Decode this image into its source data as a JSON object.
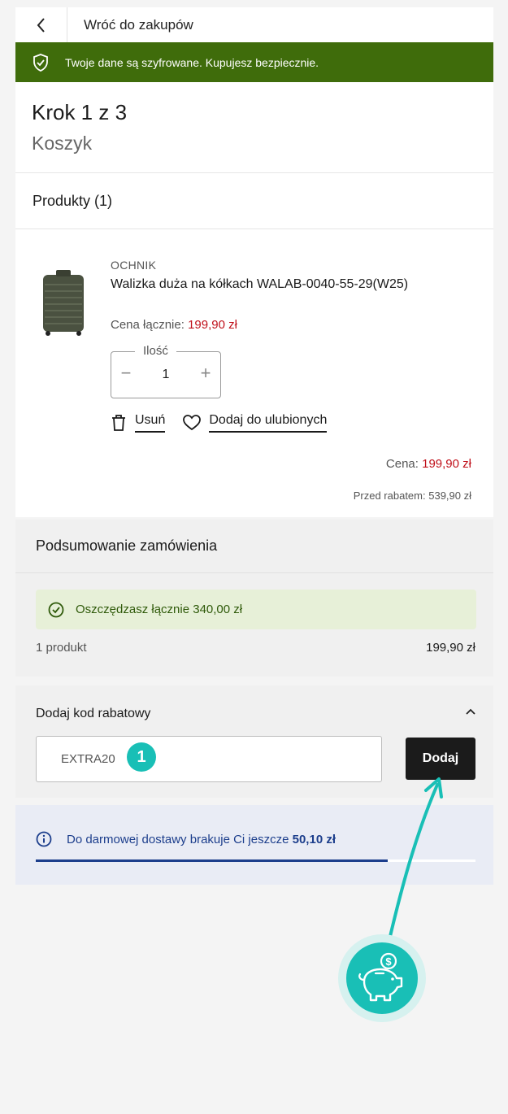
{
  "topbar": {
    "back_label": "Wróć do zakupów"
  },
  "security": {
    "text": "Twoje dane są szyfrowane. Kupujesz bezpiecznie."
  },
  "step": {
    "title": "Krok 1 z 3",
    "subtitle": "Koszyk"
  },
  "products": {
    "heading": "Produkty (1)",
    "items": [
      {
        "brand": "OCHNIK",
        "name": "Walizka duża na kółkach WALAB-0040-55-29(W25)",
        "total_label": "Cena łącznie:",
        "total_value": "199,90 zł",
        "qty_label": "Ilość",
        "qty_value": "1",
        "remove_label": "Usuń",
        "favorite_label": "Dodaj do ulubionych",
        "price_label": "Cena:",
        "price_value": "199,90 zł",
        "before_label": "Przed rabatem:",
        "before_value": "539,90 zł"
      }
    ]
  },
  "summary": {
    "heading": "Podsumowanie zamówienia",
    "savings": "Oszczędzasz łącznie 340,00 zł",
    "count_label": "1 produkt",
    "count_value": "199,90 zł"
  },
  "discount": {
    "heading": "Dodaj kod rabatowy",
    "code_value": "EXTRA20",
    "badge": "1",
    "button_label": "Dodaj"
  },
  "delivery": {
    "text": "Do darmowej dostawy brakuje Ci jeszcze",
    "amount": "50,10 zł",
    "progress_fraction": 0.8
  },
  "colors": {
    "secure_green": "#3f6c0b",
    "price_red": "#c0101a",
    "accent_teal": "#19bfb6",
    "delivery_blue": "#1c3e8c"
  },
  "icons": [
    "chevron-left-icon",
    "shield-check-icon",
    "trash-icon",
    "heart-icon",
    "check-circle-icon",
    "chevron-up-icon",
    "info-icon",
    "piggy-bank-icon"
  ]
}
